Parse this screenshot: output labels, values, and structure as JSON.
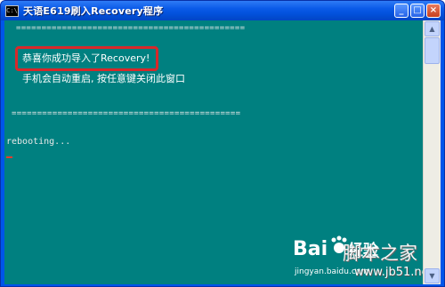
{
  "window": {
    "title": "天语E619刷入Recovery程序",
    "icon": "cmd-icon",
    "icon_text": "C:\\",
    "controls": {
      "minimize": "_",
      "maximize": "□",
      "close": "×"
    }
  },
  "console": {
    "separator_top": "=============================================",
    "success_message": "恭喜你成功导入了Recovery!",
    "restart_message": "手机会自动重启, 按任意键关闭此窗口",
    "separator_bottom": "=============================================",
    "status": "rebooting..."
  },
  "watermark": {
    "logo": "Bai 经验",
    "logo_bai": "Bai",
    "logo_paw": "paw-icon",
    "logo_jingyan": "经验",
    "jingyan_url": "jingyan.baidu.com",
    "site_name": "脚本之家",
    "site_url": "www.jb51.net"
  },
  "colors": {
    "console_bg": "#008080",
    "console_text": "#e8e8e8",
    "titlebar": "#0055ea",
    "highlight_border": "#d8282a",
    "cursor": "#e63b2e"
  }
}
